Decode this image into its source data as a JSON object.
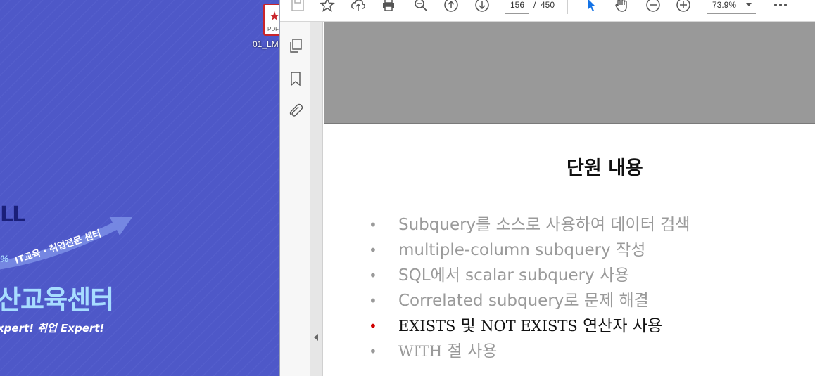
{
  "desktop": {
    "wallpaper": {
      "brand_fragment": "LL",
      "pct": "%",
      "slogan": "IT교육 · 취업전문 센터",
      "center": "산교육센터",
      "sub": "xpert! 취업 Expert!"
    },
    "icon": {
      "label": "01_LM",
      "badge": "PDF",
      "icon": "pdf-file-icon"
    }
  },
  "reader": {
    "toolbar": {
      "page_current": "156",
      "page_sep": "/",
      "page_total": "450",
      "zoom": "73.9%",
      "icons": [
        "save-icon",
        "star-icon",
        "upload-cloud-icon",
        "print-icon",
        "zoom-search-icon",
        "prev-page-icon",
        "next-page-icon",
        "select-cursor-icon",
        "hand-tool-icon",
        "zoom-out-icon",
        "zoom-in-icon",
        "more-icon"
      ]
    },
    "left_panel": {
      "icons": [
        "page-thumbnails-icon",
        "bookmark-icon",
        "attachment-icon"
      ]
    },
    "slide": {
      "title": "단원 내용",
      "bullets": [
        {
          "text": "Subquery를 소스로 사용하여 데이터 검색",
          "active": false
        },
        {
          "text": "multiple-column subquery 작성",
          "active": false
        },
        {
          "text": "SQL에서 scalar subquery 사용",
          "active": false
        },
        {
          "text": "Correlated subquery로 문제 해결",
          "active": false
        },
        {
          "kw1": "EXISTS",
          "mid": " 및 ",
          "kw2": "NOT EXISTS",
          "rest": " 연산자 사용",
          "active": true
        },
        {
          "kw1": "WITH",
          "rest": " 절 사용",
          "active": false
        }
      ],
      "bullet_symbol": "•",
      "active_bullet_color": "#d00000"
    }
  }
}
